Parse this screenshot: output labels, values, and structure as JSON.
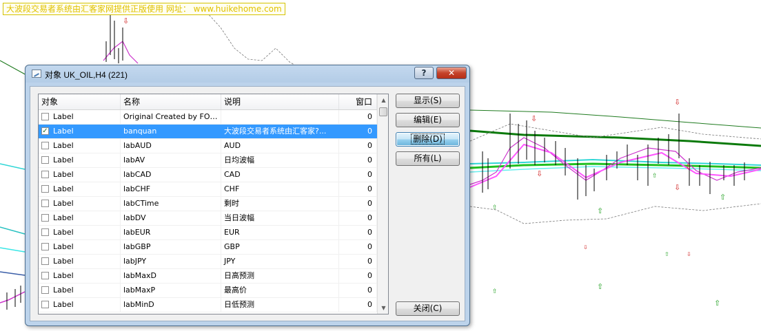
{
  "banner": {
    "text": "大波段交易者系统由汇客家网提供正版使用 网址：  www.huikehome.com"
  },
  "dialog": {
    "title": "对象 UK_OIL,H4 (221)",
    "help_label": "?",
    "close_label": "✕",
    "columns": [
      "对象",
      "名称",
      "说明",
      "窗口"
    ],
    "rows": [
      {
        "type": "Label",
        "name": "Original Created by FORE…",
        "desc": "",
        "window": "0",
        "checked": false,
        "selected": false
      },
      {
        "type": "Label",
        "name": "banquan",
        "desc": "大波段交易者系统由汇客家?...",
        "window": "0",
        "checked": true,
        "selected": true
      },
      {
        "type": "Label",
        "name": "labAUD",
        "desc": "AUD",
        "window": "0",
        "checked": false,
        "selected": false
      },
      {
        "type": "Label",
        "name": "labAV",
        "desc": "日均波幅",
        "window": "0",
        "checked": false,
        "selected": false
      },
      {
        "type": "Label",
        "name": "labCAD",
        "desc": "CAD",
        "window": "0",
        "checked": false,
        "selected": false
      },
      {
        "type": "Label",
        "name": "labCHF",
        "desc": "CHF",
        "window": "0",
        "checked": false,
        "selected": false
      },
      {
        "type": "Label",
        "name": "labCTime",
        "desc": "剩时",
        "window": "0",
        "checked": false,
        "selected": false
      },
      {
        "type": "Label",
        "name": "labDV",
        "desc": "当日波幅",
        "window": "0",
        "checked": false,
        "selected": false
      },
      {
        "type": "Label",
        "name": "labEUR",
        "desc": "EUR",
        "window": "0",
        "checked": false,
        "selected": false
      },
      {
        "type": "Label",
        "name": "labGBP",
        "desc": "GBP",
        "window": "0",
        "checked": false,
        "selected": false
      },
      {
        "type": "Label",
        "name": "labJPY",
        "desc": "JPY",
        "window": "0",
        "checked": false,
        "selected": false
      },
      {
        "type": "Label",
        "name": "labMaxD",
        "desc": "日高预测",
        "window": "0",
        "checked": false,
        "selected": false
      },
      {
        "type": "Label",
        "name": "labMaxP",
        "desc": "最高价",
        "window": "0",
        "checked": false,
        "selected": false
      },
      {
        "type": "Label",
        "name": "labMinD",
        "desc": "日低预测",
        "window": "0",
        "checked": false,
        "selected": false
      }
    ],
    "buttons": {
      "show": "显示(S)",
      "edit": "编辑(E)",
      "delete": "删除(D)",
      "all": "所有(L)",
      "close": "关闭(C)"
    }
  },
  "colors": {
    "selection": "#3399ff",
    "title_close": "#c5432b",
    "banner_text": "#e0c000"
  }
}
